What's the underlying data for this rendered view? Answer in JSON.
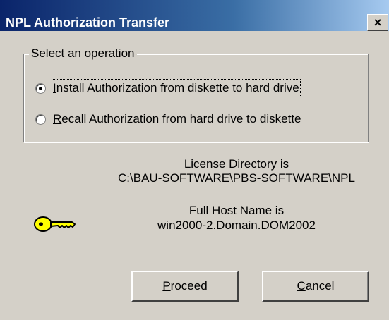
{
  "window": {
    "title": "NPL Authorization Transfer",
    "close_glyph": "×"
  },
  "group": {
    "legend": "Select an operation",
    "options": [
      {
        "accel": "I",
        "rest": "nstall Authorization from diskette to hard drive",
        "selected": true
      },
      {
        "accel": "R",
        "rest": "ecall Authorization from hard drive to diskette",
        "selected": false
      }
    ]
  },
  "license": {
    "label": "License Directory is",
    "path": "C:\\BAU-SOFTWARE\\PBS-SOFTWARE\\NPL"
  },
  "host": {
    "label": "Full Host Name is",
    "name": "win2000-2.Domain.DOM2002"
  },
  "icons": {
    "key": "key-icon",
    "close": "close-icon"
  },
  "buttons": {
    "proceed": {
      "accel": "P",
      "rest": "roceed"
    },
    "cancel": {
      "accel": "C",
      "rest": "ancel"
    }
  },
  "colors": {
    "title_start": "#0a246a",
    "title_end": "#a6caf0",
    "dialog_bg": "#d4d0c8",
    "key_fill": "#ffff00"
  }
}
